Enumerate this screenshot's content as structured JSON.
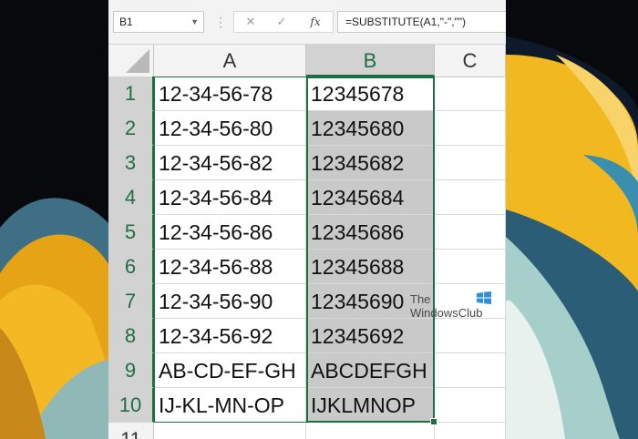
{
  "formula_bar": {
    "name_box": "B1",
    "formula": "=SUBSTITUTE(A1,\"-\",\"\")",
    "icons": [
      "cancel-x-icon",
      "enter-check-icon",
      "insert-function-icon"
    ],
    "fx_label": "fx"
  },
  "columns": [
    "A",
    "B",
    "C"
  ],
  "rows": [
    {
      "num": "1",
      "a": "12-34-56-78",
      "b": "12345678"
    },
    {
      "num": "2",
      "a": "12-34-56-80",
      "b": "12345680"
    },
    {
      "num": "3",
      "a": "12-34-56-82",
      "b": "12345682"
    },
    {
      "num": "4",
      "a": "12-34-56-84",
      "b": "12345684"
    },
    {
      "num": "5",
      "a": "12-34-56-86",
      "b": "12345686"
    },
    {
      "num": "6",
      "a": "12-34-56-88",
      "b": "12345688"
    },
    {
      "num": "7",
      "a": "12-34-56-90",
      "b": "12345690"
    },
    {
      "num": "8",
      "a": "12-34-56-92",
      "b": "12345692"
    },
    {
      "num": "9",
      "a": "AB-CD-EF-GH",
      "b": "ABCDEFGH"
    },
    {
      "num": "10",
      "a": "IJ-KL-MN-OP",
      "b": "IJKLMNOP"
    },
    {
      "num": "11",
      "a": "",
      "b": ""
    }
  ],
  "watermark": {
    "line1": "The",
    "line2": "WindowsClub"
  },
  "colors": {
    "accent_green": "#1e6e43",
    "selection_fill": "#c9c9c9",
    "wallpaper_gold": "#f0b21c",
    "wallpaper_teal": "#6fa7a8"
  }
}
